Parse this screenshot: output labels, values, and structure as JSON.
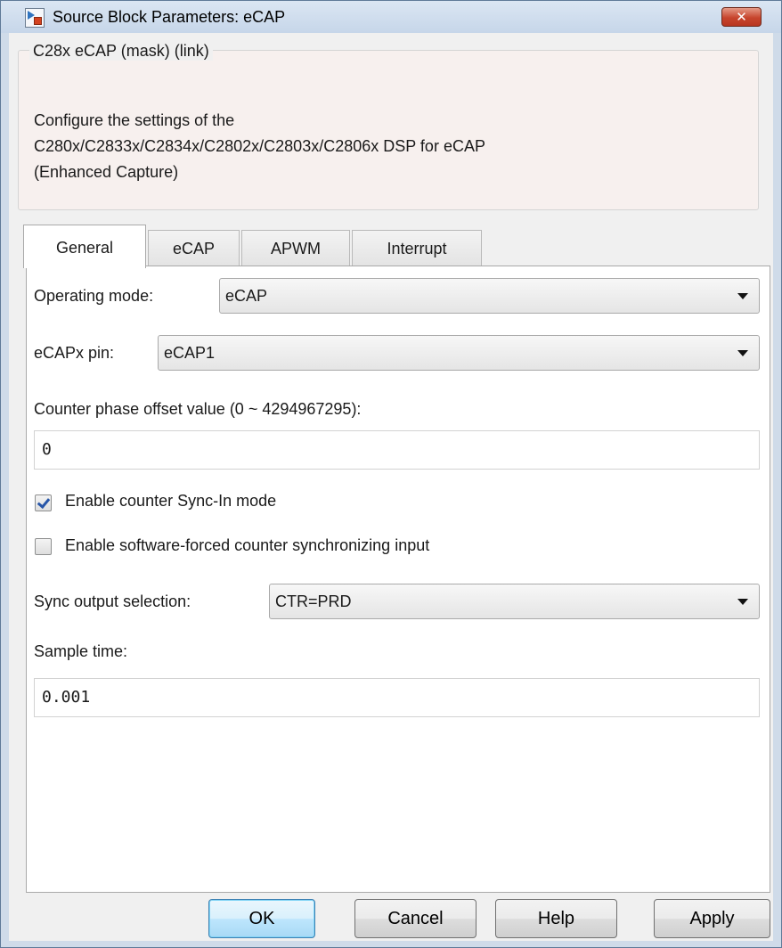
{
  "window": {
    "title": "Source Block Parameters: eCAP",
    "close_label": "✕"
  },
  "description": {
    "legend": "C28x eCAP (mask) (link)",
    "line1": "Configure the settings of the",
    "line2": "C280x/C2833x/C2834x/C2802x/C2803x/C2806x DSP for eCAP",
    "line3": "(Enhanced Capture)"
  },
  "tabs": [
    {
      "label": "General",
      "active": true
    },
    {
      "label": "eCAP",
      "active": false
    },
    {
      "label": "APWM",
      "active": false
    },
    {
      "label": "Interrupt",
      "active": false
    }
  ],
  "general": {
    "operating_mode_label": "Operating mode:",
    "operating_mode_value": "eCAP",
    "pin_label": "eCAPx pin:",
    "pin_value": "eCAP1",
    "phase_offset_label": "Counter phase offset value (0 ~ 4294967295):",
    "phase_offset_value": "0",
    "sync_in_label": "Enable counter Sync-In mode",
    "sync_in_checked": true,
    "sw_force_label": "Enable software-forced counter synchronizing input",
    "sw_force_checked": false,
    "sync_output_label": "Sync output selection:",
    "sync_output_value": "CTR=PRD",
    "sample_time_label": "Sample time:",
    "sample_time_value": "0.001"
  },
  "buttons": {
    "ok": "OK",
    "cancel": "Cancel",
    "help": "Help",
    "apply": "Apply"
  }
}
